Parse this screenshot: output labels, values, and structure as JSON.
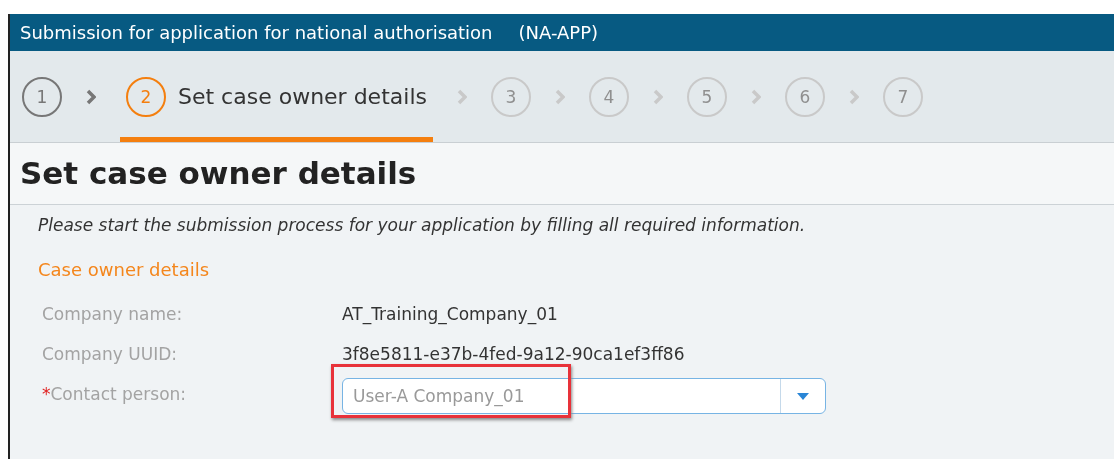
{
  "window": {
    "title": "Submission for application for national authorisation",
    "code": "(NA-APP)"
  },
  "steps": [
    {
      "number": "1",
      "kind": "done",
      "selected": false
    },
    {
      "number": "2",
      "kind": "current",
      "selected": true,
      "label": "Set case owner details"
    },
    {
      "number": "3",
      "kind": "upcoming",
      "selected": false
    },
    {
      "number": "4",
      "kind": "upcoming",
      "selected": false
    },
    {
      "number": "5",
      "kind": "upcoming",
      "selected": false
    },
    {
      "number": "6",
      "kind": "upcoming",
      "selected": false
    },
    {
      "number": "7",
      "kind": "upcoming",
      "selected": false
    }
  ],
  "heading": "Set case owner details",
  "instruction": "Please start the submission process for your application by filling all required information.",
  "section": {
    "title": "Case owner details",
    "required_mark": "*",
    "fields": [
      {
        "kind": "text",
        "label": "Company name:",
        "required": false,
        "value": "AT_Training_Company_01"
      },
      {
        "kind": "text",
        "label": "Company UUID:",
        "required": false,
        "value": "3f8e5811-e37b-4fed-9a12-90ca1ef3ff86"
      },
      {
        "kind": "combo",
        "label": "Contact person:",
        "required": true,
        "value": "User-A Company_01",
        "highlighted": true
      }
    ]
  }
}
